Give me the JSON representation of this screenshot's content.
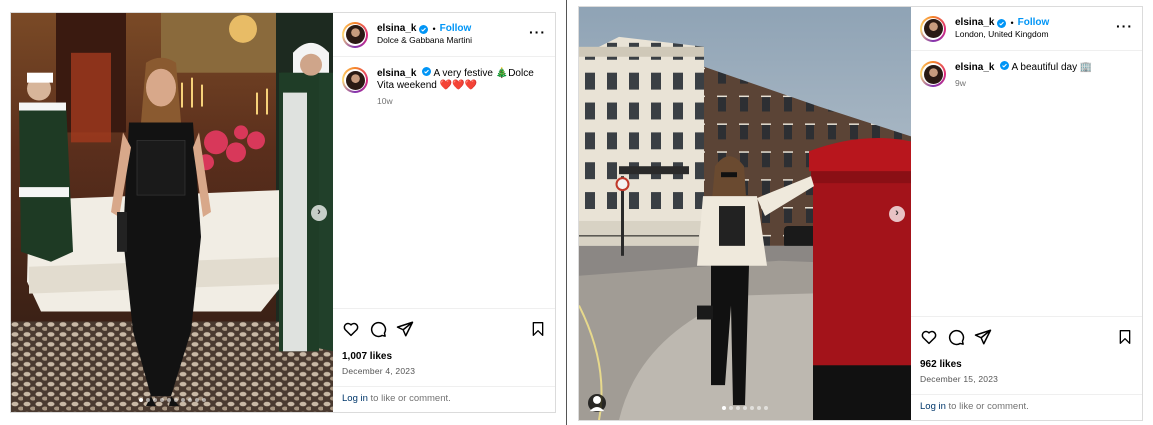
{
  "posts": [
    {
      "username": "elsina_k",
      "follow_label": "Follow",
      "separator": "•",
      "location": "Dolce & Gabbana Martini",
      "caption_text": "A very festive 🎄Dolce Vita weekend ❤️❤️❤️",
      "caption_age": "10w",
      "likes": "1,007 likes",
      "date": "December 4, 2023",
      "login_link": "Log in",
      "login_suffix": " to like or comment.",
      "carousel_dots": 10,
      "active_dot": 0,
      "icons": [
        "heart-icon",
        "comment-icon",
        "share-icon",
        "bookmark-icon",
        "more-icon",
        "chevron-right-icon"
      ]
    },
    {
      "username": "elsina_k",
      "follow_label": "Follow",
      "separator": "•",
      "location": "London, United Kingdom",
      "caption_text": "A beautiful day 🏢",
      "caption_age": "9w",
      "likes": "962 likes",
      "date": "December 15, 2023",
      "login_link": "Log in",
      "login_suffix": " to like or comment.",
      "carousel_dots": 7,
      "active_dot": 0,
      "icons": [
        "heart-icon",
        "comment-icon",
        "share-icon",
        "bookmark-icon",
        "more-icon",
        "chevron-right-icon",
        "user-tag-icon"
      ]
    }
  ],
  "colors": {
    "link_blue": "#0095f6",
    "verified_blue": "#0095f6",
    "muted_text": "#737373",
    "border": "#dbdbdb"
  }
}
